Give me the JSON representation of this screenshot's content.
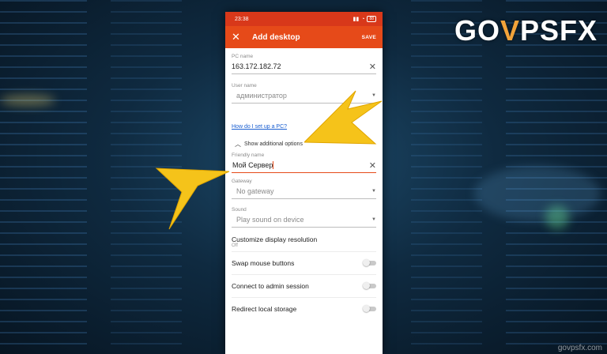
{
  "status_bar": {
    "time": "23:38",
    "battery": "88"
  },
  "app_bar": {
    "title": "Add desktop",
    "save_label": "SAVE"
  },
  "form": {
    "pc_name": {
      "label": "PC name",
      "value": "163.172.182.72"
    },
    "user_name": {
      "label": "User name",
      "value": "администратор"
    },
    "help_link": "How do I set up a PC?",
    "additional_toggle": "Show additional options",
    "friendly_name": {
      "label": "Friendly name",
      "value": "Мой Сервер"
    },
    "gateway": {
      "label": "Gateway",
      "value": "No gateway"
    },
    "sound": {
      "label": "Sound",
      "value": "Play sound on device"
    },
    "display_resolution": {
      "title": "Customize display resolution",
      "value": "Off"
    },
    "switches": [
      {
        "label": "Swap mouse buttons",
        "on": false
      },
      {
        "label": "Connect to admin session",
        "on": false
      },
      {
        "label": "Redirect local storage",
        "on": false
      }
    ]
  },
  "overlay": {
    "logo": {
      "left": "GO",
      "v": "V",
      "right": "PSFX"
    },
    "watermark": "govpsfx.com",
    "arrow_color": "#f5c31a"
  },
  "colors": {
    "accent": "#e64a19",
    "status_bar": "#d8381a",
    "link": "#1a5fd1"
  }
}
